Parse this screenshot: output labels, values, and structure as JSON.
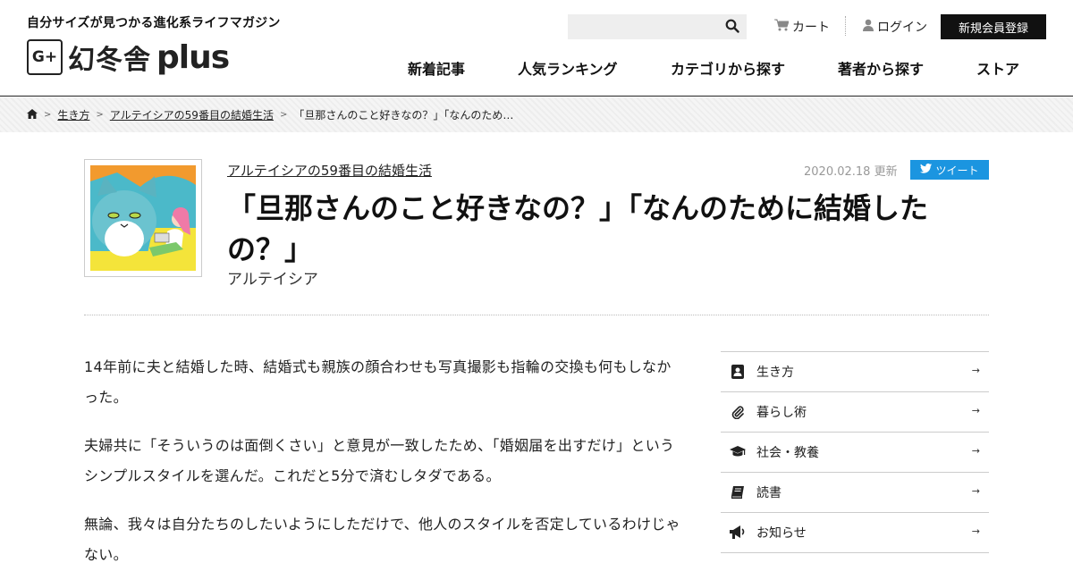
{
  "header": {
    "tagline": "自分サイズが見つかる進化系ライフマガジン",
    "logo_mark": "G+",
    "logo_text": "幻冬舎",
    "logo_plus": "plus",
    "search_placeholder": "",
    "cart_label": "カート",
    "login_label": "ログイン",
    "signup_label": "新規会員登録",
    "nav": [
      "新着記事",
      "人気ランキング",
      "カテゴリから探す",
      "著者から探す",
      "ストア"
    ]
  },
  "breadcrumb": {
    "items": [
      "生き方",
      "アルテイシアの59番目の結婚生活",
      "「旦那さんのこと好きなの？」「なんのため…"
    ]
  },
  "article": {
    "series": "アルテイシアの59番目の結婚生活",
    "date": "2020.02.18 更新",
    "tweet_label": "ツイート",
    "title": "「旦那さんのこと好きなの？」「なんのために結婚したの？」",
    "author": "アルテイシア",
    "paragraphs": [
      "14年前に夫と結婚した時、結婚式も親族の顔合わせも写真撮影も指輪の交換も何もしなかった。",
      "夫婦共に「そういうのは面倒くさい」と意見が一致したため、「婚姻届を出すだけ」というシンプルスタイルを選んだ。これだと5分で済むしタダである。",
      "無論、我々は自分たちのしたいようにしただけで、他人のスタイルを否定しているわけじゃない。"
    ]
  },
  "sidebar": {
    "items": [
      {
        "label": "生き方",
        "icon": "person-book-icon"
      },
      {
        "label": "暮らし術",
        "icon": "paperclip-icon"
      },
      {
        "label": "社会・教養",
        "icon": "graduation-cap-icon"
      },
      {
        "label": "読書",
        "icon": "book-icon"
      },
      {
        "label": "お知らせ",
        "icon": "megaphone-icon"
      }
    ],
    "arrow": "→"
  },
  "colors": {
    "accent": "#1b95e0",
    "signup_bg": "#111111"
  }
}
